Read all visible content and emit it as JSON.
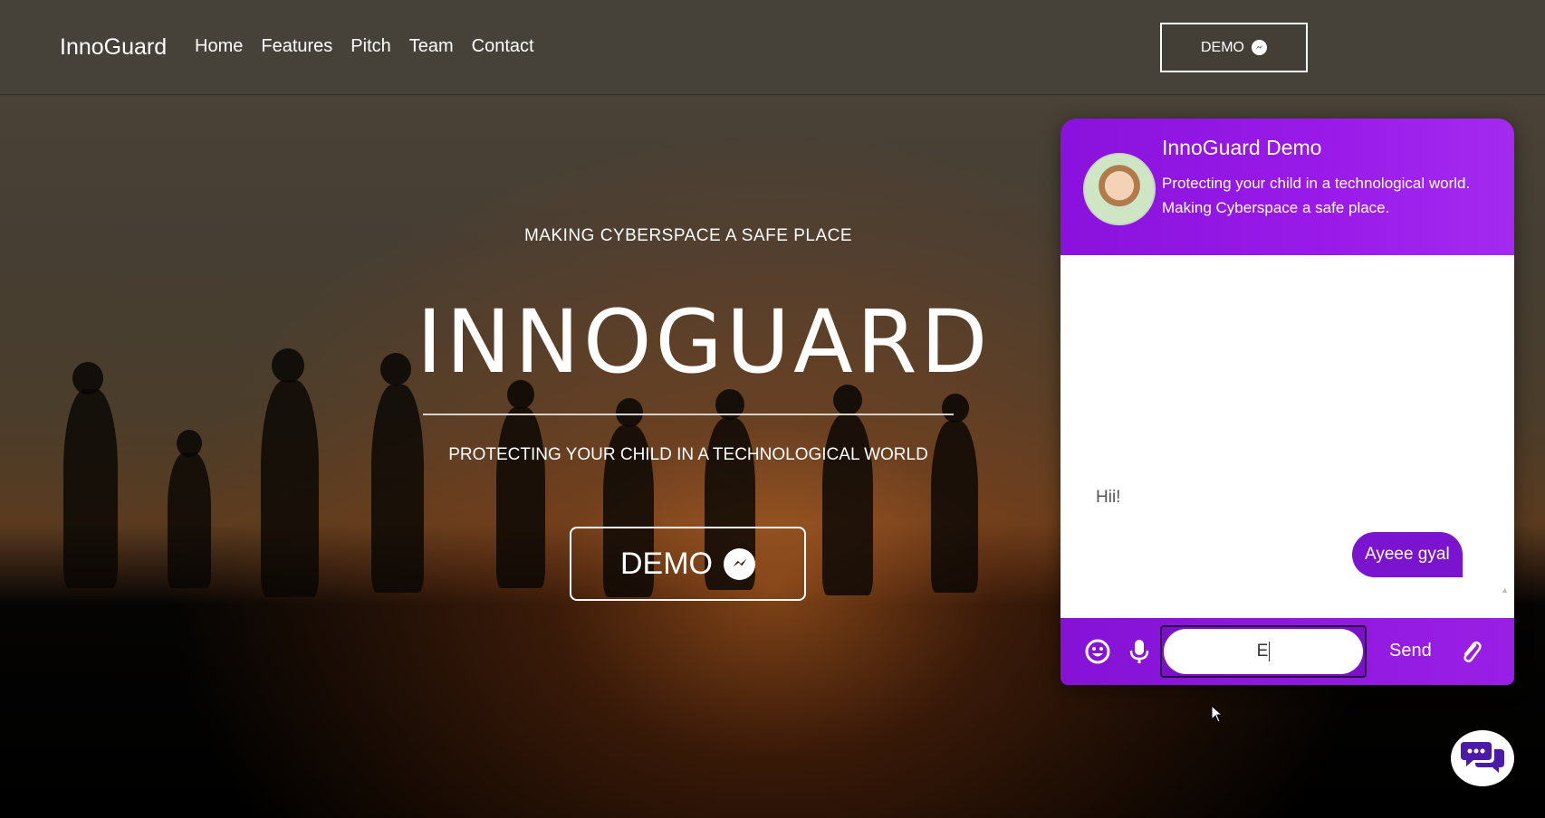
{
  "nav": {
    "brand": "InnoGuard",
    "links": [
      "Home",
      "Features",
      "Pitch",
      "Team",
      "Contact"
    ],
    "demo_label": "DEMO"
  },
  "hero": {
    "tagline": "MAKING CYBERSPACE A SAFE PLACE",
    "title": "INNOGUARD",
    "subtitle": "PROTECTING YOUR CHILD IN A TECHNOLOGICAL WORLD",
    "demo_label": "DEMO"
  },
  "chat": {
    "title": "InnoGuard Demo",
    "description": "Protecting your child in a technological world. Making Cyberspace a safe place.",
    "messages": [
      {
        "from": "bot",
        "text": "Hii!"
      },
      {
        "from": "user",
        "text": "Ayeee gyal"
      }
    ],
    "input_value": "E",
    "send_label": "Send",
    "accent_color": "#8a12dd"
  },
  "icons": {
    "nav_demo_icon": "messenger-icon",
    "hero_demo_icon": "messenger-icon",
    "emoji": "emoji-icon",
    "mic": "microphone-icon",
    "attach": "paperclip-icon",
    "launcher": "chat-bubbles-icon"
  }
}
